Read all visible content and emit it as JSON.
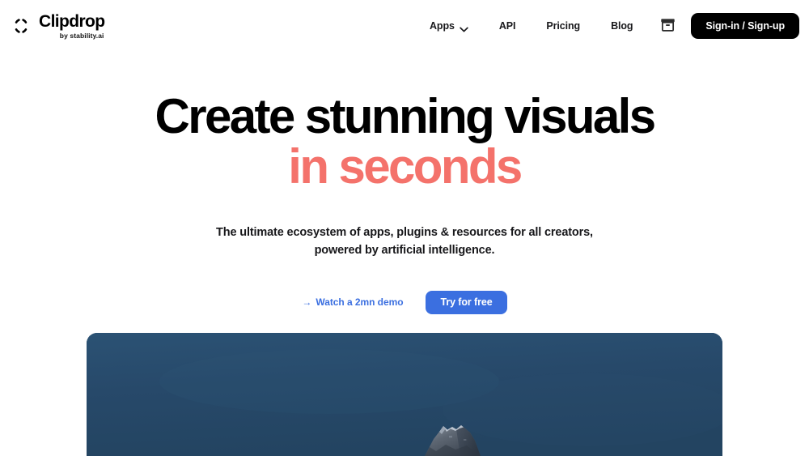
{
  "brand": {
    "name": "Clipdrop",
    "tagline": "by stability.ai",
    "icon": "focus-brackets-icon"
  },
  "nav": {
    "items": [
      {
        "label": "Apps",
        "has_dropdown": true,
        "icon": "chevron-down-icon"
      },
      {
        "label": "API",
        "has_dropdown": false
      },
      {
        "label": "Pricing",
        "has_dropdown": false
      },
      {
        "label": "Blog",
        "has_dropdown": false
      }
    ],
    "archive_icon": "archive-box-icon",
    "signin_label": "Sign-in / Sign-up"
  },
  "hero": {
    "headline_line1": "Create stunning visuals",
    "headline_line2": "in seconds",
    "subtitle_line1": "The ultimate ecosystem of apps, plugins & resources for all creators,",
    "subtitle_line2": "powered by artificial intelligence.",
    "demo_link_arrow": "→",
    "demo_link_label": "Watch a 2mn demo",
    "try_button_label": "Try for free",
    "media_alt": "mountain-peak-against-deep-blue-sky"
  },
  "colors": {
    "accent_coral": "#F4726B",
    "accent_blue": "#3B6FE0",
    "black": "#000000",
    "hero_sky_navy": "#264A68",
    "hero_sky_navy_light": "#2C5372",
    "rock_gray": "#6E7785",
    "rock_dark": "#3C4653",
    "snow_white": "#C9D2DC"
  }
}
